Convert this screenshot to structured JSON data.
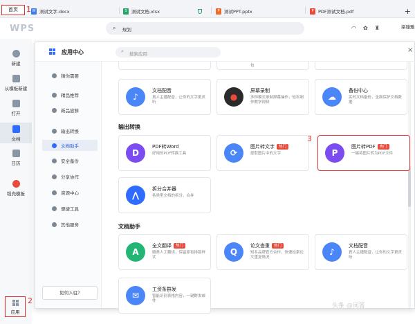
{
  "tabs": {
    "home": "首页",
    "docs": [
      {
        "label": "测试文字.docx",
        "icon_letter": "W",
        "color": "#3b7cf5"
      },
      {
        "label": "测试文档.xlsx",
        "icon_letter": "S",
        "color": "#2aa36a"
      },
      {
        "label": "测试PPT.pptx",
        "icon_letter": "P",
        "color": "#ef6b2a"
      },
      {
        "label": "PDF测试文档.pdf",
        "icon_letter": "P",
        "color": "#e84a3c"
      }
    ],
    "new_tab": "+"
  },
  "annotations": [
    "1",
    "2",
    "3"
  ],
  "toolbar": {
    "logo": "WPS",
    "search_text": "规划",
    "user": "梁雄雅"
  },
  "sidebar": {
    "items": [
      {
        "label": "新建",
        "color": "#8a95a5"
      },
      {
        "label": "从模板新建",
        "color": "#8a95a5"
      },
      {
        "label": "打开",
        "color": "#8a95a5"
      },
      {
        "label": "文档",
        "color": "#2f6bff"
      },
      {
        "label": "日历",
        "color": "#8a95a5"
      },
      {
        "label": "稻壳模板",
        "color": "#e84a3c"
      }
    ],
    "apps_label": "应用"
  },
  "panel": {
    "title": "应用中心",
    "search_placeholder": "搜索应用",
    "close": "×",
    "categories": [
      "猜你需要",
      "精品推荐",
      "新品尝鲜",
      "输出转换",
      "文档助手",
      "安全备份",
      "分享协作",
      "资源中心",
      "便捷工具",
      "其他服务"
    ],
    "active_category_index": 4,
    "join_label": "如何入驻?",
    "sections": [
      "输出转换",
      "文档助手"
    ],
    "hot_badge": "热门",
    "partial_text": "包",
    "cards": [
      {
        "name": "文档配音",
        "desc": "真人主播配音，让你的文字更灵听",
        "color": "#4a86f7",
        "glyph": "♪",
        "hot": false
      },
      {
        "name": "屏幕录制",
        "desc": "多种模式录制屏幕操作，轻松制作教学视频",
        "color": "#2b2b2b",
        "glyph": "●",
        "hot": false
      },
      {
        "name": "备份中心",
        "desc": "实时文档备份，全面保护文档数据",
        "color": "#4a86f7",
        "glyph": "☁",
        "hot": false
      },
      {
        "name": "PDF转Word",
        "desc": "好用的PDF转换工具",
        "color": "#7b4df0",
        "glyph": "D",
        "hot": false
      },
      {
        "name": "图片转文字",
        "desc": "提取图片中的文字",
        "color": "#4a86f7",
        "glyph": "⟳",
        "hot": true
      },
      {
        "name": "图片转PDF",
        "desc": "一键将图片转为PDF文件",
        "color": "#7b4df0",
        "glyph": "P",
        "hot": true
      },
      {
        "name": "拆分合并器",
        "desc": "各类型文档的拆分、合并",
        "color": "#2f6bff",
        "glyph": "⋀",
        "hot": false
      },
      {
        "name": "全文翻译",
        "desc": "媲美人工翻译，保留原有排版样式",
        "color": "#22b573",
        "glyph": "A",
        "hot": true
      },
      {
        "name": "论文查重",
        "desc": "知名品牌官方合作，快速检索论文重复情况",
        "color": "#4a86f7",
        "glyph": "Q",
        "hot": true
      },
      {
        "name": "文档配音",
        "desc": "真人主播配音，让你的文字更灵听",
        "color": "#4a86f7",
        "glyph": "♪",
        "hot": false
      },
      {
        "name": "工资条群发",
        "desc": "智能识别表格内容，一键群发邮件",
        "color": "#4a86f7",
        "glyph": "✉",
        "hot": false
      }
    ]
  },
  "watermark": "头条 @问答"
}
